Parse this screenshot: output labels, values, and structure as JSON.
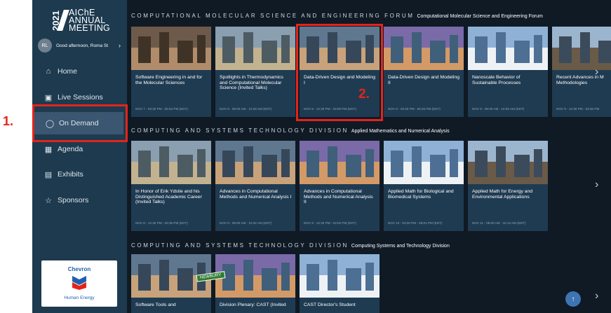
{
  "logo": {
    "year": "2021",
    "line1": "AIChE",
    "line2": "ANNUAL",
    "line3": "MEETING"
  },
  "user": {
    "initials": "RL",
    "greeting": "Good afternoon, Roma St"
  },
  "nav": [
    {
      "label": "Home",
      "icon": "home-icon"
    },
    {
      "label": "Live Sessions",
      "icon": "video-icon"
    },
    {
      "label": "On Demand",
      "icon": "chat-bubble-icon"
    },
    {
      "label": "Agenda",
      "icon": "calendar-icon"
    },
    {
      "label": "Exhibits",
      "icon": "booth-icon"
    },
    {
      "label": "Sponsors",
      "icon": "star-icon"
    }
  ],
  "sponsor": {
    "brand": "Chevron",
    "tagline": "Human Energy"
  },
  "annotations": {
    "one": "1.",
    "two": "2."
  },
  "sections": [
    {
      "title": "COMPUTATIONAL MOLECULAR SCIENCE AND ENGINEERING FORUM",
      "subtitle": "Computational Molecular Science and Engineering Forum",
      "cards": [
        {
          "title": "Software Engineering in and for the Molecular Sciences",
          "date": "NOV 7 - 03:30 PM - 05:52 PM (EDT)"
        },
        {
          "title": "Spotlights in Thermodynamics and Computational Molecular Science (Invited Talks)",
          "date": "NOV 8 - 08:00 AM - 10:28 AM (EDT)"
        },
        {
          "title": "Data-Driven Design and Modeling I",
          "date": "NOV 8 - 12:30 PM - 03:00 PM (EDT)"
        },
        {
          "title": "Data-Driven Design and Modeling II",
          "date": "NOV 8 - 03:30 PM - 05:45 PM (EDT)"
        },
        {
          "title": "Nanoscale Behavior of Sustainable Processes",
          "date": "NOV 9 - 08:00 AM - 10:08 AM (EDT)"
        },
        {
          "title": "Recent Advances in M Methodologies",
          "date": "NOV 9 - 12:30 PM - 02:50 PM"
        }
      ]
    },
    {
      "title": "COMPUTING AND SYSTEMS TECHNOLOGY DIVISION",
      "subtitle": "Applied Mathematics and Numerical Analysis",
      "cards": [
        {
          "title": "In Honor of Erik Ydstie and his Distinguished Academic Career (Invited Talks)",
          "date": "NOV 8 - 12:35 PM - 03:35 PM (EDT)"
        },
        {
          "title": "Advances in Computational Methods and Numerical Analysis I",
          "date": "NOV 9 - 08:00 AM - 10:32 AM (EDT)"
        },
        {
          "title": "Advances in Computational Methods and Numerical Analysis II",
          "date": "NOV 9 - 12:30 PM - 03:02 PM (EDT)"
        },
        {
          "title": "Applied Math for Biological and Biomedical Systems",
          "date": "NOV 10 - 03:30 PM - 06:02 PM (EDT)"
        },
        {
          "title": "Applied Math for Energy and Environmental Applications",
          "date": "NOV 11 - 08:00 AM - 10:13 AM (EDT)"
        }
      ]
    },
    {
      "title": "COMPUTING AND SYSTEMS TECHNOLOGY DIVISION",
      "subtitle": "Computing Systems and Technology Division",
      "cards": [
        {
          "title": "Software Tools and",
          "date": ""
        },
        {
          "title": "Division Plenary: CAST (Invited",
          "date": ""
        },
        {
          "title": "CAST Director's Student",
          "date": ""
        }
      ]
    }
  ],
  "street_sign": "NEWBURY",
  "colors": {
    "sidebar": "#1d3a4f",
    "background": "#0f1a25",
    "card": "#1f3b52",
    "highlight": "#e3241b",
    "accent": "#3f74b3"
  }
}
